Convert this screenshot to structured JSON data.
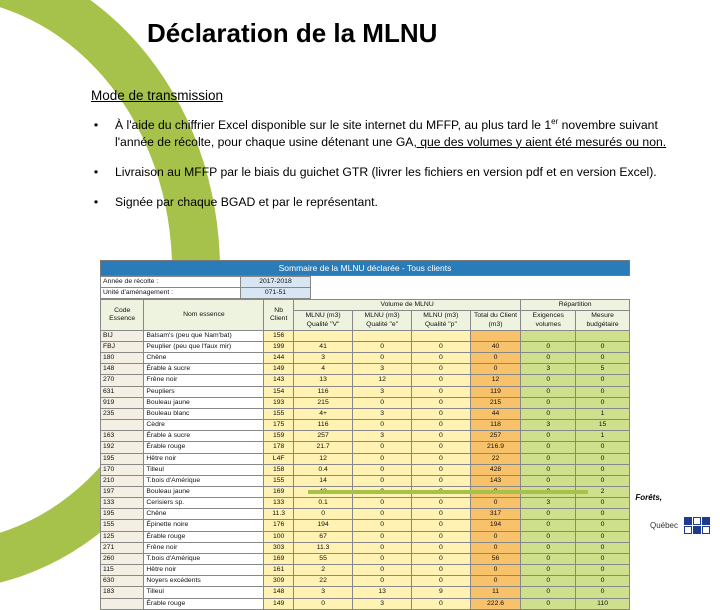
{
  "title": "Déclaration de la MLNU",
  "subhead": "Mode de transmission",
  "bullets": [
    "À l'aide du chiffrier Excel disponible sur le site internet du MFFP, au plus tard le 1<sup>er</sup> novembre suivant l'année de récolte, pour chaque usine détenant une GA<u>, que des volumes y aient été mesurés ou non.</u>",
    "Livraison au MFFP par le biais du guichet GTR (livrer les fichiers en version pdf et en version Excel).",
    "Signée par chaque BGAD et par le représentant."
  ],
  "summary_title": "Sommaire de la MLNU déclarée - Tous clients",
  "meta": {
    "l1a": "Année de récolte :",
    "l1b": "2017-2018",
    "l2a": "Unité d'aménagement :",
    "l2b": "071-51"
  },
  "col_groups": {
    "vol": "Volume de MLNU",
    "rep": "Répartition"
  },
  "cols": {
    "code": "Code Essence",
    "nom": "Nom essence",
    "nb": "Nb Client",
    "q": "MLNU (m3) Qualité \"V\"",
    "e": "MLNU (m3) Qualité \"e\"",
    "p": "MLNU (m3) Qualité \"p\"",
    "tot": "Total du Client (m3)",
    "ex": "Exigences volumes",
    "mb": "Mesure budgétaire"
  },
  "chart_data": {
    "type": "table",
    "rows": [
      {
        "c": "BIJ",
        "n": "Balsam's (peu que Nam'bat)",
        "nb": 156,
        "q": "",
        "e": "",
        "p": "",
        "t": "",
        "ex": "",
        "mb": ""
      },
      {
        "c": "FBJ",
        "n": "Peuplier (peu que l'faux mir)",
        "nb": 199,
        "q": 41,
        "e": 0,
        "p": 0,
        "t": 40,
        "ex": 0,
        "mb": 0
      },
      {
        "c": "180",
        "n": "Chêne",
        "nb": 144,
        "q": 3,
        "e": 0,
        "p": 0,
        "t": 0,
        "ex": 0,
        "mb": 0
      },
      {
        "c": "148",
        "n": "Érable à sucre",
        "nb": 149,
        "q": 4,
        "e": 3,
        "p": 0,
        "t": 0,
        "ex": 3,
        "mb": 5
      },
      {
        "c": "270",
        "n": "Frêne noir",
        "nb": 143,
        "q": 13,
        "e": 12,
        "p": 0,
        "t": 12,
        "ex": 0,
        "mb": 0
      },
      {
        "c": "631",
        "n": "Peupliers",
        "nb": 154,
        "q": 116,
        "e": 3,
        "p": 0,
        "t": 119,
        "ex": 0,
        "mb": 0
      },
      {
        "c": "919",
        "n": "Bouleau jaune",
        "nb": 193,
        "q": 215,
        "e": 0,
        "p": 0,
        "t": 215,
        "ex": 0,
        "mb": 0
      },
      {
        "c": "235",
        "n": "Bouleau blanc",
        "nb": 155,
        "q": "4+",
        "e": 3,
        "p": 0,
        "t": 44,
        "ex": 0,
        "mb": 1
      },
      {
        "c": "",
        "n": "Cèdre",
        "nb": 175,
        "q": 116,
        "e": 0,
        "p": 0,
        "t": 118,
        "ex": 3,
        "mb": 15
      },
      {
        "c": "163",
        "n": "Érable à sucre",
        "nb": 159,
        "q": 257,
        "e": 3,
        "p": 0,
        "t": 257,
        "ex": 0,
        "mb": 1
      },
      {
        "c": "192",
        "n": "Érable rouge",
        "nb": 178,
        "q": "21.7",
        "e": 0,
        "p": 0,
        "t": "216.9",
        "ex": 0,
        "mb": 0
      },
      {
        "c": "195",
        "n": "Hêtre noir",
        "nb": "L4F",
        "q": 12,
        "e": 0,
        "p": 0,
        "t": 22,
        "ex": 0,
        "mb": 0
      },
      {
        "c": "170",
        "n": "Tilleul",
        "nb": 158,
        "q": "0.4",
        "e": 0,
        "p": 0,
        "t": 428,
        "ex": 0,
        "mb": 0
      },
      {
        "c": "210",
        "n": "T.bois d'Amérique",
        "nb": 155,
        "q": 14,
        "e": 0,
        "p": 0,
        "t": 143,
        "ex": 0,
        "mb": 0
      },
      {
        "c": "197",
        "n": "Bouleau jaune",
        "nb": 169,
        "q": 48,
        "e": 0,
        "p": 0,
        "t": 0,
        "ex": 0,
        "mb": 2
      },
      {
        "c": "133",
        "n": "Cerisiers sp.",
        "nb": 133,
        "q": "0.1",
        "e": 0,
        "p": 0,
        "t": 0,
        "ex": 3,
        "mb": 0
      },
      {
        "c": "195",
        "n": "Chêne",
        "nb": "11.3",
        "q": 0,
        "e": 0,
        "p": 0,
        "t": 317,
        "ex": 0,
        "mb": 0
      },
      {
        "c": "155",
        "n": "Épinette noire",
        "nb": 176,
        "q": 194,
        "e": 0,
        "p": 0,
        "t": 194,
        "ex": 0,
        "mb": 0
      },
      {
        "c": "125",
        "n": "Érable rouge",
        "nb": 100,
        "q": 67,
        "e": 0,
        "p": 0,
        "t": 0,
        "ex": 0,
        "mb": 0
      },
      {
        "c": "271",
        "n": "Frêne noir",
        "nb": 303,
        "q": "11.3",
        "e": 0,
        "p": 0,
        "t": 0,
        "ex": 0,
        "mb": 0
      },
      {
        "c": "260",
        "n": "T.bois d'Amérique",
        "nb": 169,
        "q": 55,
        "e": 0,
        "p": 0,
        "t": 56,
        "ex": 0,
        "mb": 0
      },
      {
        "c": "115",
        "n": "Hêtre noir",
        "nb": 161,
        "q": 2,
        "e": 0,
        "p": 0,
        "t": 0,
        "ex": 0,
        "mb": 0
      },
      {
        "c": "630",
        "n": "Noyers excédents",
        "nb": 309,
        "q": 22,
        "e": 0,
        "p": 0,
        "t": 0,
        "ex": 0,
        "mb": 0
      },
      {
        "c": "183",
        "n": "Tilleul",
        "nb": 148,
        "q": 3,
        "e": 13,
        "p": 9,
        "t": 11,
        "ex": 0,
        "mb": 0
      },
      {
        "c": "",
        "n": "Érable rouge",
        "nb": 149,
        "q": 0,
        "e": 3,
        "p": 0,
        "t": "222.6",
        "ex": 0,
        "mb": 110
      }
    ]
  },
  "footer": {
    "foret": "Forêts,",
    "qc": "Québec"
  }
}
